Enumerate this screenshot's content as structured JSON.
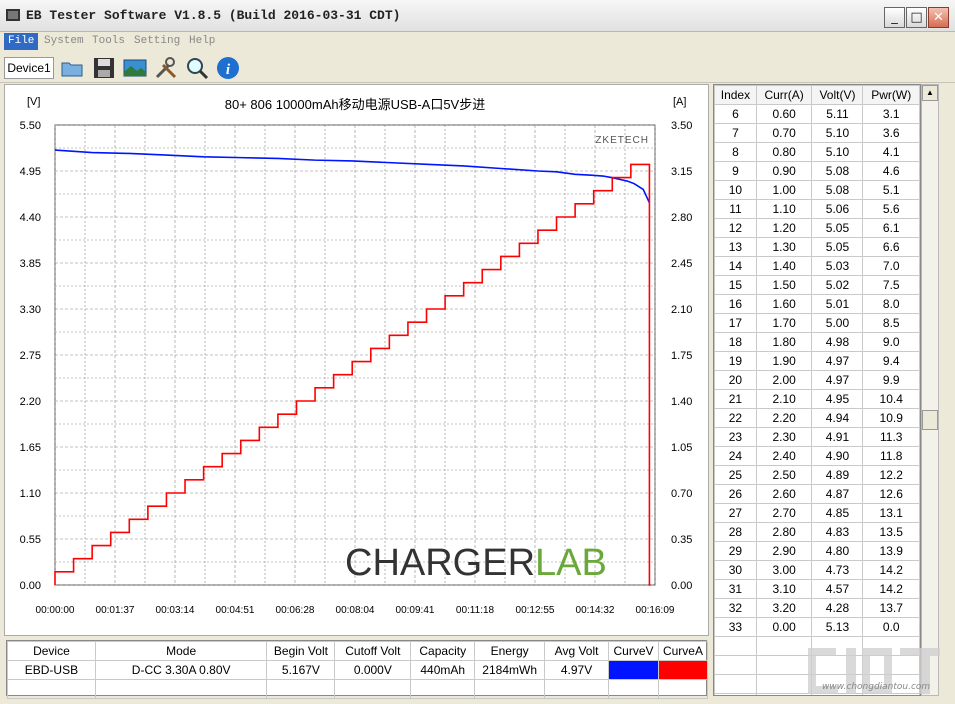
{
  "window": {
    "title": "EB Tester Software V1.8.5 (Build 2016-03-31 CDT)",
    "min_label": "_",
    "max_label": "□",
    "close_label": "✕"
  },
  "menu": [
    "File",
    "System",
    "Tools",
    "Setting",
    "Help"
  ],
  "toolbar": {
    "device_tab": "Device1",
    "icons": [
      "folder-icon",
      "save-icon",
      "picture-icon",
      "tools-icon",
      "search-icon",
      "info-icon"
    ]
  },
  "colors": {
    "voltage": "#0014ff",
    "current": "#ff0000",
    "grid": "#888888",
    "watermark_green": "#6aa83a"
  },
  "watermark": {
    "charger_c": "C",
    "charger_rest": "HARGER",
    "lab": "LAB",
    "zketech": "ZKETECH",
    "url": "www.chongdiantou.com"
  },
  "chart_data": {
    "type": "line",
    "title": "80+ 806 10000mAh移动电源USB-A口5V步进",
    "y_left_unit": "[V]",
    "y_right_unit": "[A]",
    "y_left_ticks": [
      "5.50",
      "4.95",
      "4.40",
      "3.85",
      "3.30",
      "2.75",
      "2.20",
      "1.65",
      "1.10",
      "0.55",
      "0.00"
    ],
    "y_right_ticks": [
      "3.50",
      "3.15",
      "2.80",
      "2.45",
      "2.10",
      "1.75",
      "1.40",
      "1.05",
      "0.70",
      "0.35",
      "0.00"
    ],
    "ylim_left": [
      0,
      5.5
    ],
    "ylim_right": [
      0,
      3.5
    ],
    "xlim": [
      0,
      969
    ],
    "x_ticks": [
      "00:00:00",
      "00:01:37",
      "00:03:14",
      "00:04:51",
      "00:06:28",
      "00:08:04",
      "00:09:41",
      "00:11:18",
      "00:12:55",
      "00:14:32",
      "00:16:09"
    ],
    "grid": true,
    "series": [
      {
        "name": "CurveV",
        "axis": "left",
        "color": "#0014ff",
        "x": [
          0,
          60,
          120,
          180,
          240,
          300,
          360,
          420,
          480,
          540,
          600,
          660,
          720,
          780,
          810,
          840,
          866,
          885,
          900,
          912,
          924,
          935,
          950,
          960
        ],
        "y": [
          5.2,
          5.17,
          5.16,
          5.14,
          5.12,
          5.11,
          5.1,
          5.08,
          5.07,
          5.05,
          5.03,
          5.01,
          4.98,
          4.95,
          4.94,
          4.91,
          4.9,
          4.89,
          4.87,
          4.85,
          4.83,
          4.8,
          4.73,
          4.57
        ]
      },
      {
        "name": "CurveA",
        "axis": "right",
        "color": "#ff0000",
        "x": [
          0,
          30,
          60,
          90,
          120,
          150,
          180,
          210,
          240,
          270,
          300,
          330,
          360,
          390,
          420,
          450,
          480,
          510,
          540,
          570,
          600,
          630,
          660,
          690,
          720,
          750,
          780,
          810,
          840,
          870,
          900,
          930,
          956,
          960,
          962
        ],
        "y": [
          0.1,
          0.2,
          0.3,
          0.4,
          0.5,
          0.6,
          0.7,
          0.8,
          0.9,
          1.0,
          1.1,
          1.2,
          1.3,
          1.4,
          1.5,
          1.6,
          1.7,
          1.8,
          1.9,
          2.0,
          2.1,
          2.2,
          2.3,
          2.4,
          2.5,
          2.6,
          2.7,
          2.8,
          2.9,
          3.0,
          3.1,
          3.2,
          3.2,
          0.0,
          0.0
        ]
      }
    ]
  },
  "table": {
    "headers": [
      "Index",
      "Curr(A)",
      "Volt(V)",
      "Pwr(W)"
    ],
    "rows": [
      [
        "6",
        "0.60",
        "5.11",
        "3.1"
      ],
      [
        "7",
        "0.70",
        "5.10",
        "3.6"
      ],
      [
        "8",
        "0.80",
        "5.10",
        "4.1"
      ],
      [
        "9",
        "0.90",
        "5.08",
        "4.6"
      ],
      [
        "10",
        "1.00",
        "5.08",
        "5.1"
      ],
      [
        "11",
        "1.10",
        "5.06",
        "5.6"
      ],
      [
        "12",
        "1.20",
        "5.05",
        "6.1"
      ],
      [
        "13",
        "1.30",
        "5.05",
        "6.6"
      ],
      [
        "14",
        "1.40",
        "5.03",
        "7.0"
      ],
      [
        "15",
        "1.50",
        "5.02",
        "7.5"
      ],
      [
        "16",
        "1.60",
        "5.01",
        "8.0"
      ],
      [
        "17",
        "1.70",
        "5.00",
        "8.5"
      ],
      [
        "18",
        "1.80",
        "4.98",
        "9.0"
      ],
      [
        "19",
        "1.90",
        "4.97",
        "9.4"
      ],
      [
        "20",
        "2.00",
        "4.97",
        "9.9"
      ],
      [
        "21",
        "2.10",
        "4.95",
        "10.4"
      ],
      [
        "22",
        "2.20",
        "4.94",
        "10.9"
      ],
      [
        "23",
        "2.30",
        "4.91",
        "11.3"
      ],
      [
        "24",
        "2.40",
        "4.90",
        "11.8"
      ],
      [
        "25",
        "2.50",
        "4.89",
        "12.2"
      ],
      [
        "26",
        "2.60",
        "4.87",
        "12.6"
      ],
      [
        "27",
        "2.70",
        "4.85",
        "13.1"
      ],
      [
        "28",
        "2.80",
        "4.83",
        "13.5"
      ],
      [
        "29",
        "2.90",
        "4.80",
        "13.9"
      ],
      [
        "30",
        "3.00",
        "4.73",
        "14.2"
      ],
      [
        "31",
        "3.10",
        "4.57",
        "14.2"
      ],
      [
        "32",
        "3.20",
        "4.28",
        "13.7"
      ],
      [
        "33",
        "0.00",
        "5.13",
        "0.0"
      ]
    ]
  },
  "summary": {
    "headers": [
      "Device",
      "Mode",
      "Begin Volt",
      "Cutoff Volt",
      "Capacity",
      "Energy",
      "Avg Volt",
      "CurveV",
      "CurveA"
    ],
    "row": [
      "EBD-USB",
      "D-CC  3.30A  0.80V",
      "5.167V",
      "0.000V",
      "440mAh",
      "2184mWh",
      "4.97V"
    ]
  }
}
